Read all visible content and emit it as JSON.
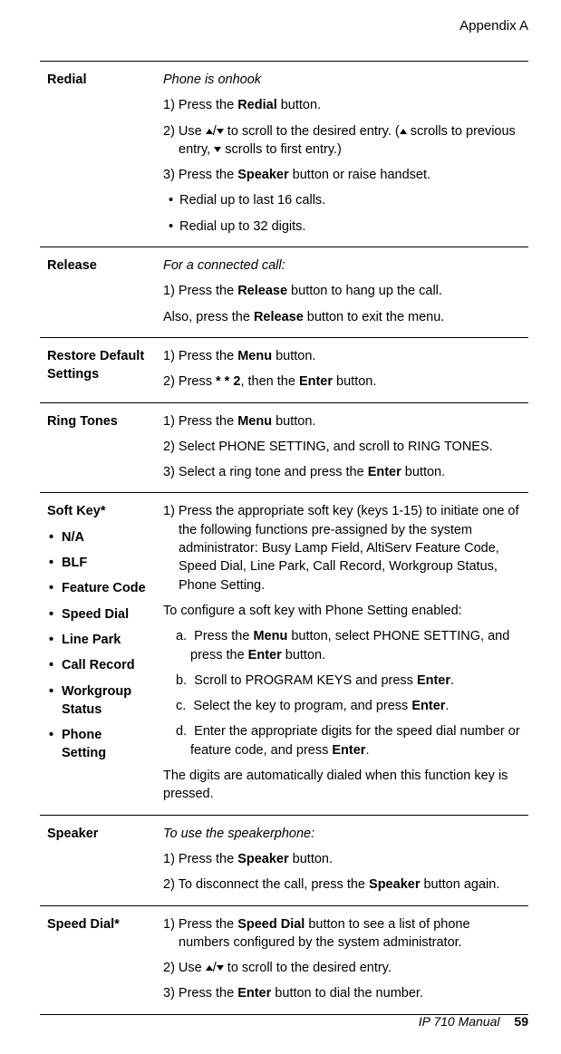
{
  "header": "Appendix A",
  "footer": {
    "title": "IP 710 Manual",
    "page": "59"
  },
  "rows": {
    "redial": {
      "label": "Redial",
      "lead": "Phone is onhook",
      "p1a": "1) Press the ",
      "p1b": "Redial",
      "p1c": " button.",
      "p2a": "2) Use ",
      "p2b": " to scroll to the desired entry. (",
      "p2c": " scrolls to previous entry, ",
      "p2d": "  scrolls to first entry.)",
      "p3a": "3) Press the ",
      "p3b": "Speaker",
      "p3c": " button or raise handset.",
      "b1": "Redial up to last 16 calls.",
      "b2": "Redial up to 32 digits."
    },
    "release": {
      "label": "Release",
      "lead": "For a connected call:",
      "p1a": "1) Press the ",
      "p1b": "Release",
      "p1c": " button to hang up the call.",
      "p2a": "Also, press the ",
      "p2b": "Release",
      "p2c": " button to exit the menu."
    },
    "restore": {
      "label": "Restore Default Settings",
      "p1a": "1) Press the ",
      "p1b": "Menu",
      "p1c": " button.",
      "p2a": "2) Press ",
      "p2b": "* * 2",
      "p2c": ", then the ",
      "p2d": "Enter",
      "p2e": " button."
    },
    "ring": {
      "label": "Ring Tones",
      "p1a": "1) Press the ",
      "p1b": "Menu",
      "p1c": " button.",
      "p2": "2) Select PHONE SETTING, and scroll to RING TONES.",
      "p3a": "3) Select a ring tone and press the ",
      "p3b": "Enter",
      "p3c": " button."
    },
    "softkey": {
      "label": "Soft Key*",
      "items": [
        "N/A",
        "BLF",
        "Feature Code",
        "Speed Dial",
        "Line Park",
        "Call Record",
        "Workgroup Status",
        "Phone Setting"
      ],
      "p1": "1) Press the appropriate soft key (keys 1-15) to initiate one of the following functions pre-assigned by the system administrator: Busy Lamp Field, AltiServ Feature Code, Speed Dial, Line Park, Call Record, Workgroup Status, Phone Setting.",
      "p2": "To configure a soft key with Phone Setting enabled:",
      "la": "a.",
      "a_1": "Press the ",
      "a_2": "Menu",
      "a_3": " button, select PHONE SETTING, and press the ",
      "a_4": "Enter",
      "a_5": " button.",
      "lb": "b.",
      "b_1": "Scroll to PROGRAM KEYS and press ",
      "b_2": "Enter",
      "b_3": ".",
      "lc": "c.",
      "c_1": "Select the key to program, and press ",
      "c_2": "Enter",
      "c_3": ".",
      "ld": "d.",
      "d_1": "Enter the appropriate digits for the speed dial number or feature code, and press ",
      "d_2": "Enter",
      "d_3": ".",
      "p3": "The digits are automatically dialed when this function key is pressed."
    },
    "speaker": {
      "label": "Speaker",
      "lead": "To use the speakerphone:",
      "p1a": "1) Press the ",
      "p1b": "Speaker",
      "p1c": " button.",
      "p2a": "2) To disconnect the call, press the ",
      "p2b": "Speaker",
      "p2c": " button again."
    },
    "speeddial": {
      "label": "Speed Dial*",
      "p1a": "1) Press the ",
      "p1b": "Speed Dial",
      "p1c": " button to see a list of phone numbers configured by the system administrator.",
      "p2a": "2) Use ",
      "p2b": " to scroll to the desired entry.",
      "p3a": "3) Press the ",
      "p3b": "Enter",
      "p3c": " button to dial the number."
    }
  }
}
